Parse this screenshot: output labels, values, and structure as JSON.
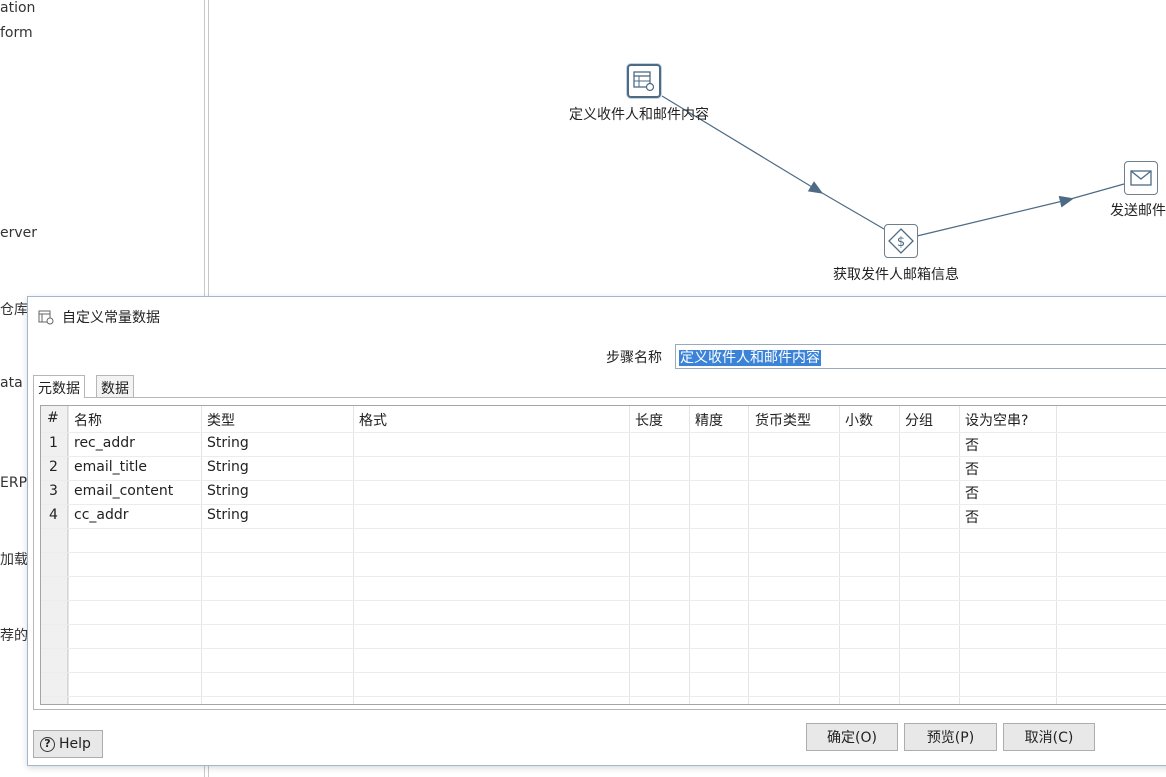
{
  "left_tree": {
    "items": [
      "ation",
      "form",
      "erver",
      "仓库",
      "ata",
      "ERP",
      "加载",
      "荐的"
    ]
  },
  "canvas": {
    "steps": [
      {
        "label": "定义收件人和邮件内容",
        "icon": "data-grid-icon"
      },
      {
        "label": "获取发件人邮箱信息",
        "icon": "dollar-script-icon"
      },
      {
        "label": "发送邮件",
        "icon": "envelope-icon"
      }
    ]
  },
  "dialog": {
    "title": "自定义常量数据",
    "step_name_label": "步骤名称",
    "step_name_value": "定义收件人和邮件内容",
    "tabs": [
      {
        "label": "元数据",
        "active": true
      },
      {
        "label": "数据",
        "active": false
      }
    ],
    "grid": {
      "headers": [
        "#",
        "名称",
        "类型",
        "格式",
        "长度",
        "精度",
        "货币类型",
        "小数",
        "分组",
        "设为空串?"
      ],
      "rows": [
        [
          "1",
          "rec_addr",
          "String",
          "",
          "",
          "",
          "",
          "",
          "",
          "否"
        ],
        [
          "2",
          "email_title",
          "String",
          "",
          "",
          "",
          "",
          "",
          "",
          "否"
        ],
        [
          "3",
          "email_content",
          "String",
          "",
          "",
          "",
          "",
          "",
          "",
          "否"
        ],
        [
          "4",
          "cc_addr",
          "String",
          "",
          "",
          "",
          "",
          "",
          "",
          "否"
        ]
      ]
    },
    "buttons": {
      "help": "Help",
      "ok": "确定(O)",
      "preview": "预览(P)",
      "cancel": "取消(C)"
    }
  },
  "colors": {
    "accent": "#3b83d6",
    "hop_line": "#4d6b84",
    "dialog_border": "#9db8cf"
  }
}
